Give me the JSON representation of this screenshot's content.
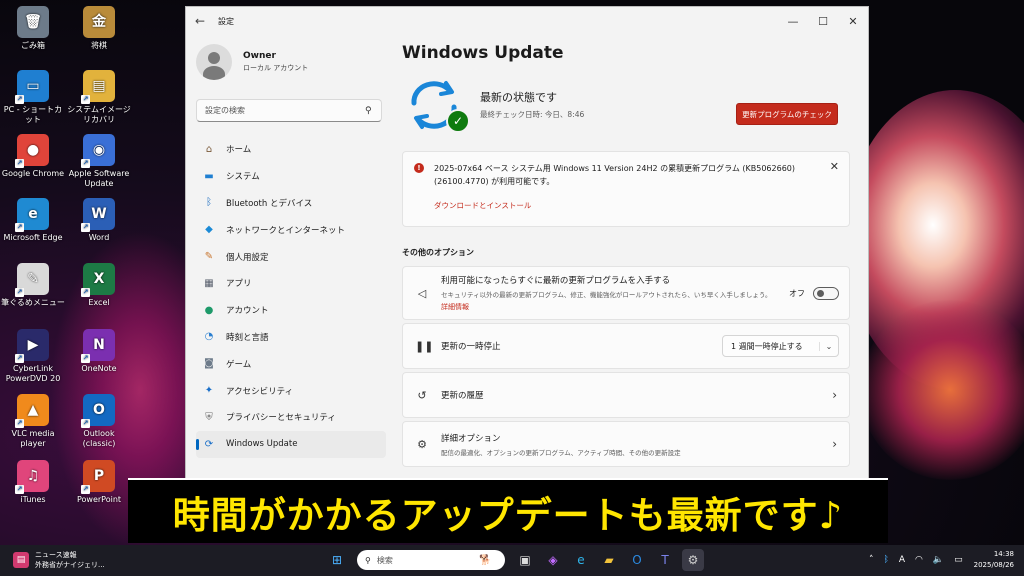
{
  "desktop": {
    "icons": [
      {
        "label": "ごみ箱",
        "glyph": "🗑",
        "color": "#6d7b8a"
      },
      {
        "label": "将棋",
        "glyph": "金",
        "color": "#b98b3a"
      },
      {
        "label": "PC - ショートカット",
        "glyph": "▭",
        "color": "#1f7fd1"
      },
      {
        "label": "システムイメージリカバリ",
        "glyph": "▤",
        "color": "#e2b23c"
      },
      {
        "label": "Google Chrome",
        "glyph": "●",
        "color": "#e0443a"
      },
      {
        "label": "Apple Software Update",
        "glyph": "◉",
        "color": "#3a6fd6"
      },
      {
        "label": "Microsoft Edge",
        "glyph": "e",
        "color": "#1f8ad2"
      },
      {
        "label": "Word",
        "glyph": "W",
        "color": "#2b5fb6"
      },
      {
        "label": "筆ぐるめメニュー",
        "glyph": "✎",
        "color": "#d9d9d9"
      },
      {
        "label": "Excel",
        "glyph": "X",
        "color": "#1d7a45"
      },
      {
        "label": "CyberLink PowerDVD 20",
        "glyph": "▶",
        "color": "#2a2a6a"
      },
      {
        "label": "OneNote",
        "glyph": "N",
        "color": "#7b2fb0"
      },
      {
        "label": "VLC media player",
        "glyph": "▲",
        "color": "#f08a1c"
      },
      {
        "label": "Outlook (classic)",
        "glyph": "O",
        "color": "#1369c2"
      },
      {
        "label": "iTunes",
        "glyph": "♫",
        "color": "#e0457b"
      },
      {
        "label": "PowerPoint",
        "glyph": "P",
        "color": "#d04a23"
      }
    ]
  },
  "window": {
    "back_icon": "←",
    "title": "設定",
    "minimize": "—",
    "maximize": "☐",
    "close": "✕"
  },
  "sidebar": {
    "user_name": "Owner",
    "account_type": "ローカル アカウント",
    "search_placeholder": "設定の検索",
    "search_icon": "⚲",
    "items": [
      {
        "label": "ホーム",
        "icon": "⌂",
        "color": "#7a5a3a"
      },
      {
        "label": "システム",
        "icon": "▬",
        "color": "#1f7fd1"
      },
      {
        "label": "Bluetooth とデバイス",
        "icon": "ᛒ",
        "color": "#1f6fc0"
      },
      {
        "label": "ネットワークとインターネット",
        "icon": "◆",
        "color": "#1b8ad6"
      },
      {
        "label": "個人用設定",
        "icon": "✎",
        "color": "#c8742d"
      },
      {
        "label": "アプリ",
        "icon": "▦",
        "color": "#555c6a"
      },
      {
        "label": "アカウント",
        "icon": "●",
        "color": "#1e9a6a"
      },
      {
        "label": "時刻と言語",
        "icon": "◔",
        "color": "#2a7fd0"
      },
      {
        "label": "ゲーム",
        "icon": "◙",
        "color": "#6d7b8a"
      },
      {
        "label": "アクセシビリティ",
        "icon": "✦",
        "color": "#1a6fc8"
      },
      {
        "label": "プライバシーとセキュリティ",
        "icon": "⛨",
        "color": "#6d6d6d"
      },
      {
        "label": "Windows Update",
        "icon": "⟳",
        "color": "#1a6fc8"
      }
    ]
  },
  "main": {
    "page_title": "Windows Update",
    "status_title": "最新の状態です",
    "last_checked": "最終チェック日時: 今日、8:46",
    "check_button": "更新プログラムのチェック",
    "notice_text": "2025-07x64 ベース システム用 Windows 11 Version 24H2 の累積更新プログラム (KB5062660) (26100.4770) が利用可能です。",
    "notice_link": "ダウンロードとインストール",
    "notice_close": "✕",
    "other_options_heading": "その他のオプション",
    "latest_updates_title": "利用可能になったらすぐに最新の更新プログラムを入手する",
    "latest_updates_desc": "セキュリティ以外の最新の更新プログラム、修正、機能強化がロールアウトされたら、いち早く入手しましょう。",
    "latest_updates_link": "詳細情報",
    "latest_updates_state": "オフ",
    "pause_title": "更新の一時停止",
    "pause_value": "1 週間一時停止する",
    "history_title": "更新の履歴",
    "advanced_title": "詳細オプション",
    "advanced_desc": "配信の最適化、オプションの更新プログラム、アクティブ時間、その他の更新設定"
  },
  "caption": "時間がかかるアップデートも最新です♪",
  "taskbar": {
    "news_title": "ニュース速報",
    "news_sub": "外務省がナイジェリ...",
    "search_label": "検索",
    "time": "14:38",
    "date": "2025/08/26",
    "ime": "A"
  }
}
